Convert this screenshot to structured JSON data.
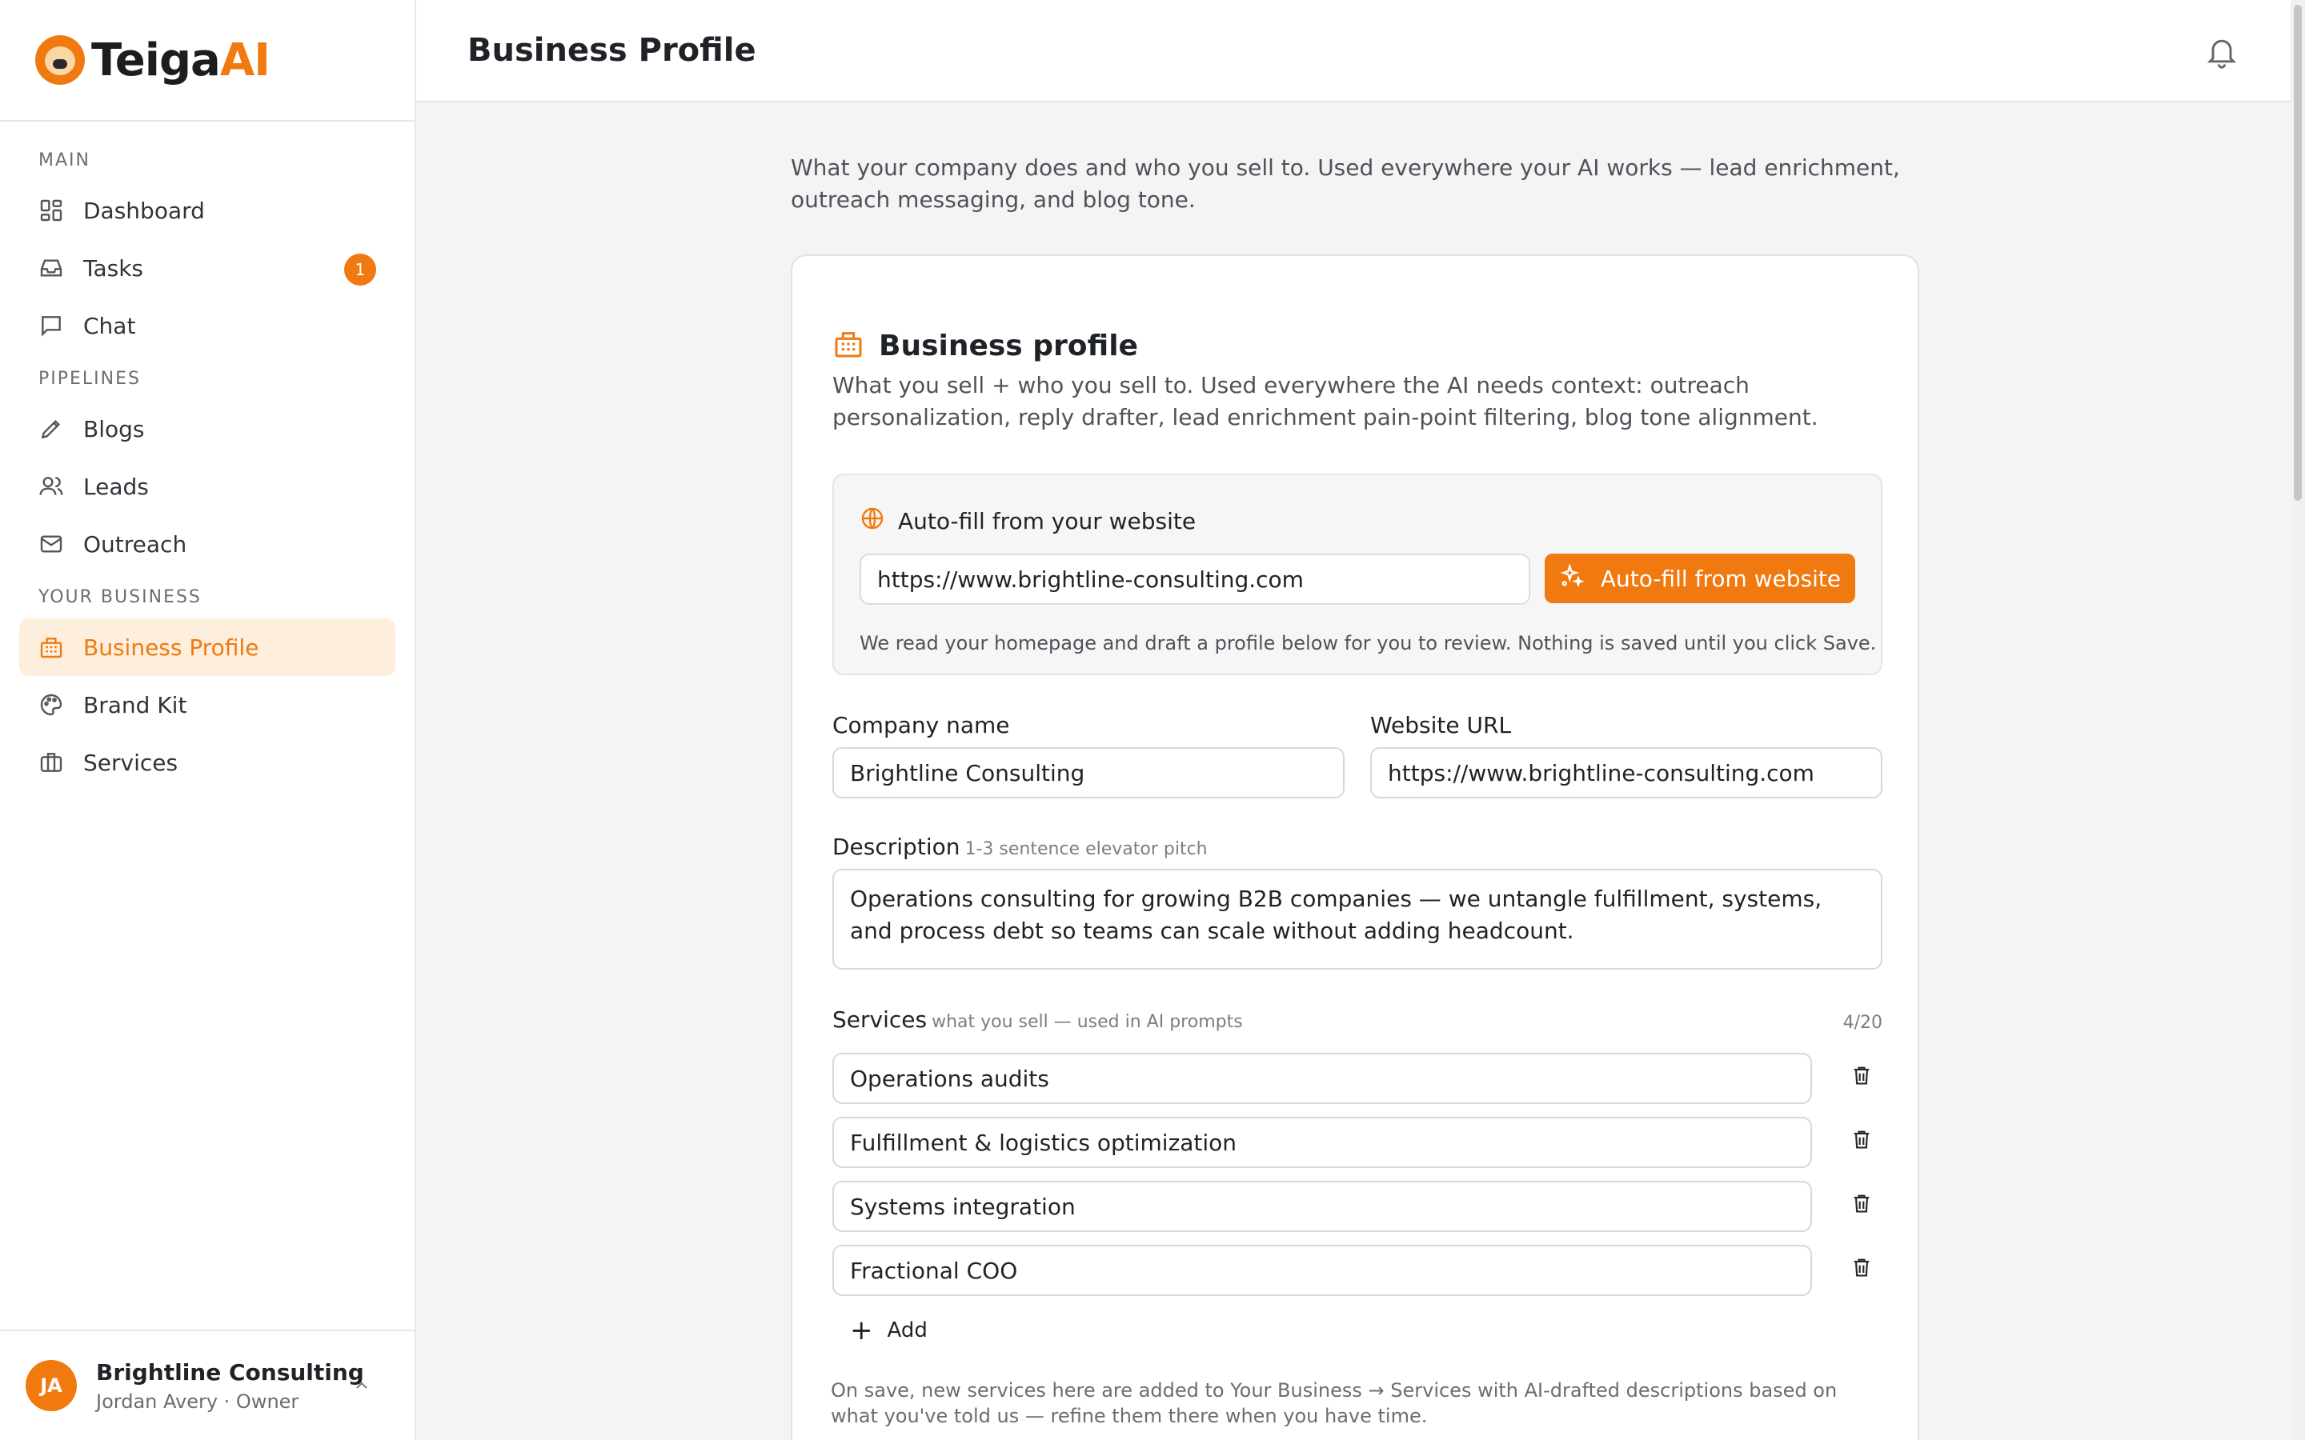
{
  "brand": {
    "name_part1": "Teiga",
    "name_part2": "AI"
  },
  "sidebar": {
    "sections": [
      {
        "label": "MAIN",
        "items": [
          {
            "label": "Dashboard",
            "icon": "dashboard-icon"
          },
          {
            "label": "Tasks",
            "icon": "inbox-icon",
            "badge": "1"
          },
          {
            "label": "Chat",
            "icon": "chat-icon"
          }
        ]
      },
      {
        "label": "PIPELINES",
        "items": [
          {
            "label": "Blogs",
            "icon": "pencil-icon"
          },
          {
            "label": "Leads",
            "icon": "users-icon"
          },
          {
            "label": "Outreach",
            "icon": "mail-icon"
          }
        ]
      },
      {
        "label": "YOUR BUSINESS",
        "items": [
          {
            "label": "Business Profile",
            "icon": "building-icon",
            "active": true
          },
          {
            "label": "Brand Kit",
            "icon": "palette-icon"
          },
          {
            "label": "Services",
            "icon": "briefcase-icon"
          }
        ]
      }
    ],
    "user": {
      "initials": "JA",
      "org": "Brightline Consulting",
      "role": "Jordan Avery · Owner"
    }
  },
  "header": {
    "title": "Business Profile"
  },
  "intro": "What your company does and who you sell to. Used everywhere your AI works — lead enrichment, outreach messaging, and blog tone.",
  "card": {
    "title": "Business profile",
    "subtitle": "What you sell + who you sell to. Used everywhere the AI needs context: outreach personalization, reply drafter, lead enrichment pain-point filtering, blog tone alignment.",
    "autofill": {
      "title": "Auto-fill from your website",
      "url_value": "https://www.brightline-consulting.com",
      "button_label": "Auto-fill from website",
      "note": "We read your homepage and draft a profile below for you to review. Nothing is saved until you click Save."
    },
    "company_name": {
      "label": "Company name",
      "value": "Brightline Consulting"
    },
    "website_url": {
      "label": "Website URL",
      "value": "https://www.brightline-consulting.com"
    },
    "description": {
      "label": "Description",
      "hint": "1-3 sentence elevator pitch",
      "value": "Operations consulting for growing B2B companies — we untangle fulfillment, systems, and process debt so teams can scale without adding headcount."
    },
    "services": {
      "label": "Services",
      "hint": "what you sell — used in AI prompts",
      "counter": "4/20",
      "items": [
        "Operations audits",
        "Fulfillment & logistics optimization",
        "Systems integration",
        "Fractional COO"
      ],
      "add_label": "Add",
      "note": "On save, new services here are added to Your Business → Services with AI-drafted descriptions based on what you've told us — refine them there when you have time."
    }
  },
  "colors": {
    "accent": "#f07a10",
    "accent_soft": "#fdeedd"
  }
}
